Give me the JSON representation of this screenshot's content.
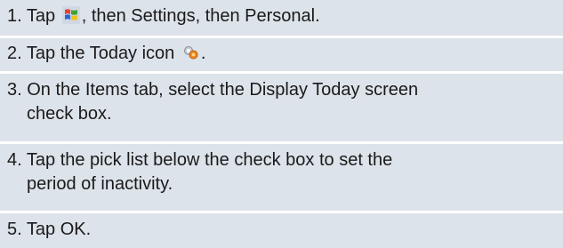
{
  "steps": [
    {
      "number": "1.",
      "before_icon": "Tap",
      "icon": "windows-start-icon",
      "after_icon": ", then Settings, then Personal."
    },
    {
      "number": "2.",
      "before_icon": "Tap the Today icon",
      "icon": "today-icon",
      "after_icon": "."
    },
    {
      "number": "3.",
      "line1": "On the Items tab, select the Display Today screen",
      "line2": "check box."
    },
    {
      "number": "4.",
      "line1": "Tap the pick list below the check box to set the",
      "line2": "period of inactivity."
    },
    {
      "number": "5.",
      "line1": "Tap OK."
    }
  ]
}
